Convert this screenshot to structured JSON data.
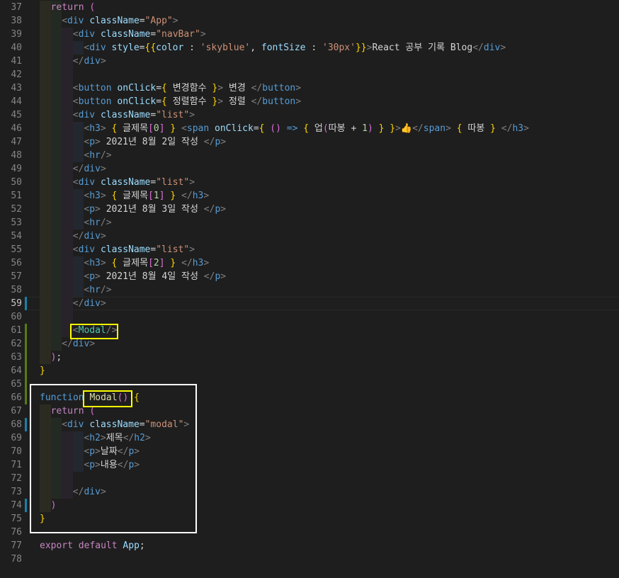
{
  "editor": {
    "lines": [
      {
        "n": "37",
        "text": "return ("
      },
      {
        "n": "38",
        "text": "<div className=\"App\">"
      },
      {
        "n": "39",
        "text": "<div className=\"navBar\">"
      },
      {
        "n": "40",
        "text": "<div style={{color : 'skyblue', fontSize : '30px'}}>React 공부 기록 Blog</div>"
      },
      {
        "n": "41",
        "text": "</div>"
      },
      {
        "n": "42",
        "text": ""
      },
      {
        "n": "43",
        "text": "<button onClick={ 변경함수 }> 변경 </button>"
      },
      {
        "n": "44",
        "text": "<button onClick={ 정렬함수 }> 정렬 </button>"
      },
      {
        "n": "45",
        "text": "<div className=\"list\">"
      },
      {
        "n": "46",
        "text": "<h3> { 글제목[0] } <span onClick={ () => { 업(따봉 + 1) } }>👍</span> { 따봉 } </h3>"
      },
      {
        "n": "47",
        "text": "<p> 2021년 8월 2일 작성 </p>"
      },
      {
        "n": "48",
        "text": "<hr/>"
      },
      {
        "n": "49",
        "text": "</div>"
      },
      {
        "n": "50",
        "text": "<div className=\"list\">"
      },
      {
        "n": "51",
        "text": "<h3> { 글제목[1] } </h3>"
      },
      {
        "n": "52",
        "text": "<p> 2021년 8월 3일 작성 </p>"
      },
      {
        "n": "53",
        "text": "<hr/>"
      },
      {
        "n": "54",
        "text": "</div>"
      },
      {
        "n": "55",
        "text": "<div className=\"list\">"
      },
      {
        "n": "56",
        "text": "<h3> { 글제목[2] } </h3>"
      },
      {
        "n": "57",
        "text": "<p> 2021년 8월 4일 작성 </p>"
      },
      {
        "n": "58",
        "text": "<hr/>"
      },
      {
        "n": "59",
        "text": "</div>"
      },
      {
        "n": "60",
        "text": ""
      },
      {
        "n": "61",
        "text": "<Modal/>"
      },
      {
        "n": "62",
        "text": "</div>"
      },
      {
        "n": "63",
        "text": ");"
      },
      {
        "n": "64",
        "text": "}"
      },
      {
        "n": "65",
        "text": ""
      },
      {
        "n": "66",
        "text": "function Modal() {"
      },
      {
        "n": "67",
        "text": "return ("
      },
      {
        "n": "68",
        "text": "<div className=\"modal\">"
      },
      {
        "n": "69",
        "text": "<h2>제목</h2>"
      },
      {
        "n": "70",
        "text": "<p>날짜</p>"
      },
      {
        "n": "71",
        "text": "<p>내용</p>"
      },
      {
        "n": "72",
        "text": ""
      },
      {
        "n": "73",
        "text": "</div>"
      },
      {
        "n": "74",
        "text": ")"
      },
      {
        "n": "75",
        "text": "}"
      },
      {
        "n": "76",
        "text": ""
      },
      {
        "n": "77",
        "text": "export default App;"
      },
      {
        "n": "78",
        "text": ""
      }
    ],
    "active_line": "59"
  },
  "colors": {
    "background": "#1e1e1e",
    "annotation_yellow": "#ffff00",
    "annotation_white": "#ffffff"
  }
}
